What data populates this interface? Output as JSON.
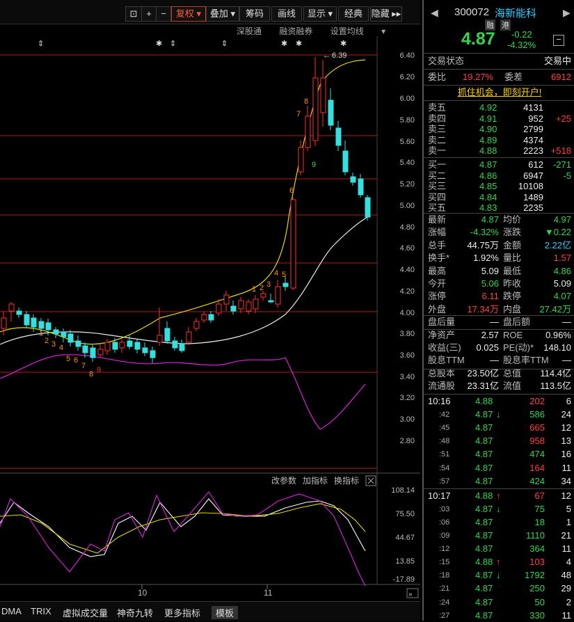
{
  "toolbar": {
    "items": [
      "复权",
      "叠加",
      "筹码",
      "画线",
      "显示",
      "经典",
      "隐藏"
    ],
    "selected": "复权"
  },
  "toplinks": [
    "深股通",
    "融资融券",
    "设置均线"
  ],
  "chart": {
    "y_labels": [
      "6.40",
      "6.20",
      "6.00",
      "5.80",
      "5.60",
      "5.40",
      "5.20",
      "5.00",
      "4.80",
      "4.60",
      "4.40",
      "4.20",
      "4.00",
      "3.80",
      "3.60",
      "3.40",
      "3.20",
      "3.00",
      "2.80"
    ],
    "high_marker": "6.39",
    "td_labels_low": [
      "1",
      "2",
      "3",
      "4",
      "5",
      "6",
      "7",
      "8",
      "9"
    ],
    "td_labels_high": [
      "1",
      "2",
      "3",
      "4",
      "5",
      "6",
      "7",
      "8",
      "9"
    ],
    "indicator_menu": [
      "改参数",
      "加指标",
      "换指标"
    ],
    "indicator_y": [
      "108.14",
      "75.50",
      "44.67",
      "13.85",
      "-17.89"
    ],
    "x_labels": [
      "10",
      "11"
    ],
    "bottom_tabs": [
      "DMA",
      "TRIX",
      "虚拟成交量",
      "神奇九转",
      "更多指标",
      "模板"
    ],
    "active_tab": "模板"
  },
  "panel": {
    "code": "300072",
    "name": "海新能科",
    "tags": [
      "融",
      "港"
    ],
    "price": "4.87",
    "change": "-0.22",
    "change_pct": "-4.32%",
    "trade_state_label": "交易状态",
    "trade_state": "交易中",
    "weibi_label": "委比",
    "weibi": "19.27%",
    "weicha_label": "委差",
    "weicha": "6912",
    "ad": "抓住机会，即刻开户!",
    "sells": [
      {
        "label": "卖五",
        "price": "4.92",
        "vol": "4131",
        "chg": ""
      },
      {
        "label": "卖四",
        "price": "4.91",
        "vol": "952",
        "chg": "+25"
      },
      {
        "label": "卖三",
        "price": "4.90",
        "vol": "2799",
        "chg": ""
      },
      {
        "label": "卖二",
        "price": "4.89",
        "vol": "4374",
        "chg": ""
      },
      {
        "label": "卖一",
        "price": "4.88",
        "vol": "2223",
        "chg": "+518"
      }
    ],
    "buys": [
      {
        "label": "买一",
        "price": "4.87",
        "vol": "612",
        "chg": "-271"
      },
      {
        "label": "买二",
        "price": "4.86",
        "vol": "6947",
        "chg": "-5"
      },
      {
        "label": "买三",
        "price": "4.85",
        "vol": "10108",
        "chg": ""
      },
      {
        "label": "买四",
        "price": "4.84",
        "vol": "1489",
        "chg": ""
      },
      {
        "label": "买五",
        "price": "4.83",
        "vol": "2235",
        "chg": ""
      }
    ],
    "stats": [
      {
        "l1": "最新",
        "v1": "4.87",
        "c1": "green",
        "l2": "均价",
        "v2": "4.97",
        "c2": "green"
      },
      {
        "l1": "涨幅",
        "v1": "-4.32%",
        "c1": "green",
        "l2": "涨跌",
        "v2": "▼0.22",
        "c2": "green"
      },
      {
        "l1": "总手",
        "v1": "44.75万",
        "c1": "white",
        "l2": "金额",
        "v2": "2.22亿",
        "c2": "cyan"
      },
      {
        "l1": "换手*",
        "v1": "1.92%",
        "c1": "white",
        "l2": "量比",
        "v2": "1.57",
        "c2": "red"
      },
      {
        "l1": "最高",
        "v1": "5.09",
        "c1": "white",
        "l2": "最低",
        "v2": "4.86",
        "c2": "green"
      },
      {
        "l1": "今开",
        "v1": "5.06",
        "c1": "green",
        "l2": "昨收",
        "v2": "5.09",
        "c2": "white"
      },
      {
        "l1": "涨停",
        "v1": "6.11",
        "c1": "red",
        "l2": "跌停",
        "v2": "4.07",
        "c2": "green"
      },
      {
        "l1": "外盘",
        "v1": "17.34万",
        "c1": "red",
        "l2": "内盘",
        "v2": "27.42万",
        "c2": "green"
      },
      {
        "l1": "盘后量",
        "v1": "—",
        "c1": "white",
        "l2": "盘后额",
        "v2": "—",
        "c2": "white"
      },
      {
        "l1": "净资产",
        "v1": "2.57",
        "c1": "white",
        "l2": "ROE",
        "v2": "0.96%",
        "c2": "white"
      },
      {
        "l1": "收益(三)",
        "v1": "0.025",
        "c1": "white",
        "l2": "PE(动)*",
        "v2": "148.10",
        "c2": "white"
      },
      {
        "l1": "股息TTM",
        "v1": "—",
        "c1": "white",
        "l2": "股息率TTM",
        "v2": "—",
        "c2": "white"
      },
      {
        "l1": "总股本",
        "v1": "23.50亿",
        "c1": "white",
        "l2": "总值",
        "v2": "114.4亿",
        "c2": "white"
      },
      {
        "l1": "流通股",
        "v1": "23.31亿",
        "c1": "white",
        "l2": "流值",
        "v2": "113.5亿",
        "c2": "white"
      }
    ],
    "ticks": [
      {
        "time": "10:16",
        "price": "4.88",
        "arrow": "",
        "vol": "202",
        "vc": "red",
        "n": "6"
      },
      {
        "time": ":42",
        "price": "4.87",
        "arrow": "↓",
        "vol": "586",
        "vc": "green",
        "n": "24"
      },
      {
        "time": ":45",
        "price": "4.87",
        "arrow": "",
        "vol": "665",
        "vc": "red",
        "n": "12"
      },
      {
        "time": ":48",
        "price": "4.87",
        "arrow": "",
        "vol": "958",
        "vc": "red",
        "n": "13"
      },
      {
        "time": ":51",
        "price": "4.87",
        "arrow": "",
        "vol": "474",
        "vc": "green",
        "n": "16"
      },
      {
        "time": ":54",
        "price": "4.87",
        "arrow": "",
        "vol": "164",
        "vc": "red",
        "n": "11"
      },
      {
        "time": ":57",
        "price": "4.87",
        "arrow": "",
        "vol": "424",
        "vc": "green",
        "n": "34"
      },
      {
        "time": "10:17",
        "price": "4.88",
        "arrow": "↑",
        "vol": "67",
        "vc": "red",
        "n": "12"
      },
      {
        "time": ":03",
        "price": "4.87",
        "arrow": "↓",
        "vol": "75",
        "vc": "green",
        "n": "5"
      },
      {
        "time": ":06",
        "price": "4.87",
        "arrow": "",
        "vol": "18",
        "vc": "green",
        "n": "1"
      },
      {
        "time": ":09",
        "price": "4.87",
        "arrow": "",
        "vol": "1110",
        "vc": "green",
        "n": "21"
      },
      {
        "time": ":12",
        "price": "4.87",
        "arrow": "",
        "vol": "364",
        "vc": "green",
        "n": "11"
      },
      {
        "time": ":15",
        "price": "4.88",
        "arrow": "↑",
        "vol": "103",
        "vc": "red",
        "n": "4"
      },
      {
        "time": ":18",
        "price": "4.87",
        "arrow": "↓",
        "vol": "1792",
        "vc": "green",
        "n": "48"
      },
      {
        "time": ":21",
        "price": "4.87",
        "arrow": "",
        "vol": "250",
        "vc": "green",
        "n": "29"
      },
      {
        "time": ":24",
        "price": "4.87",
        "arrow": "",
        "vol": "50",
        "vc": "green",
        "n": "2"
      },
      {
        "time": ":27",
        "price": "4.87",
        "arrow": "",
        "vol": "330",
        "vc": "green",
        "n": "11"
      }
    ]
  }
}
